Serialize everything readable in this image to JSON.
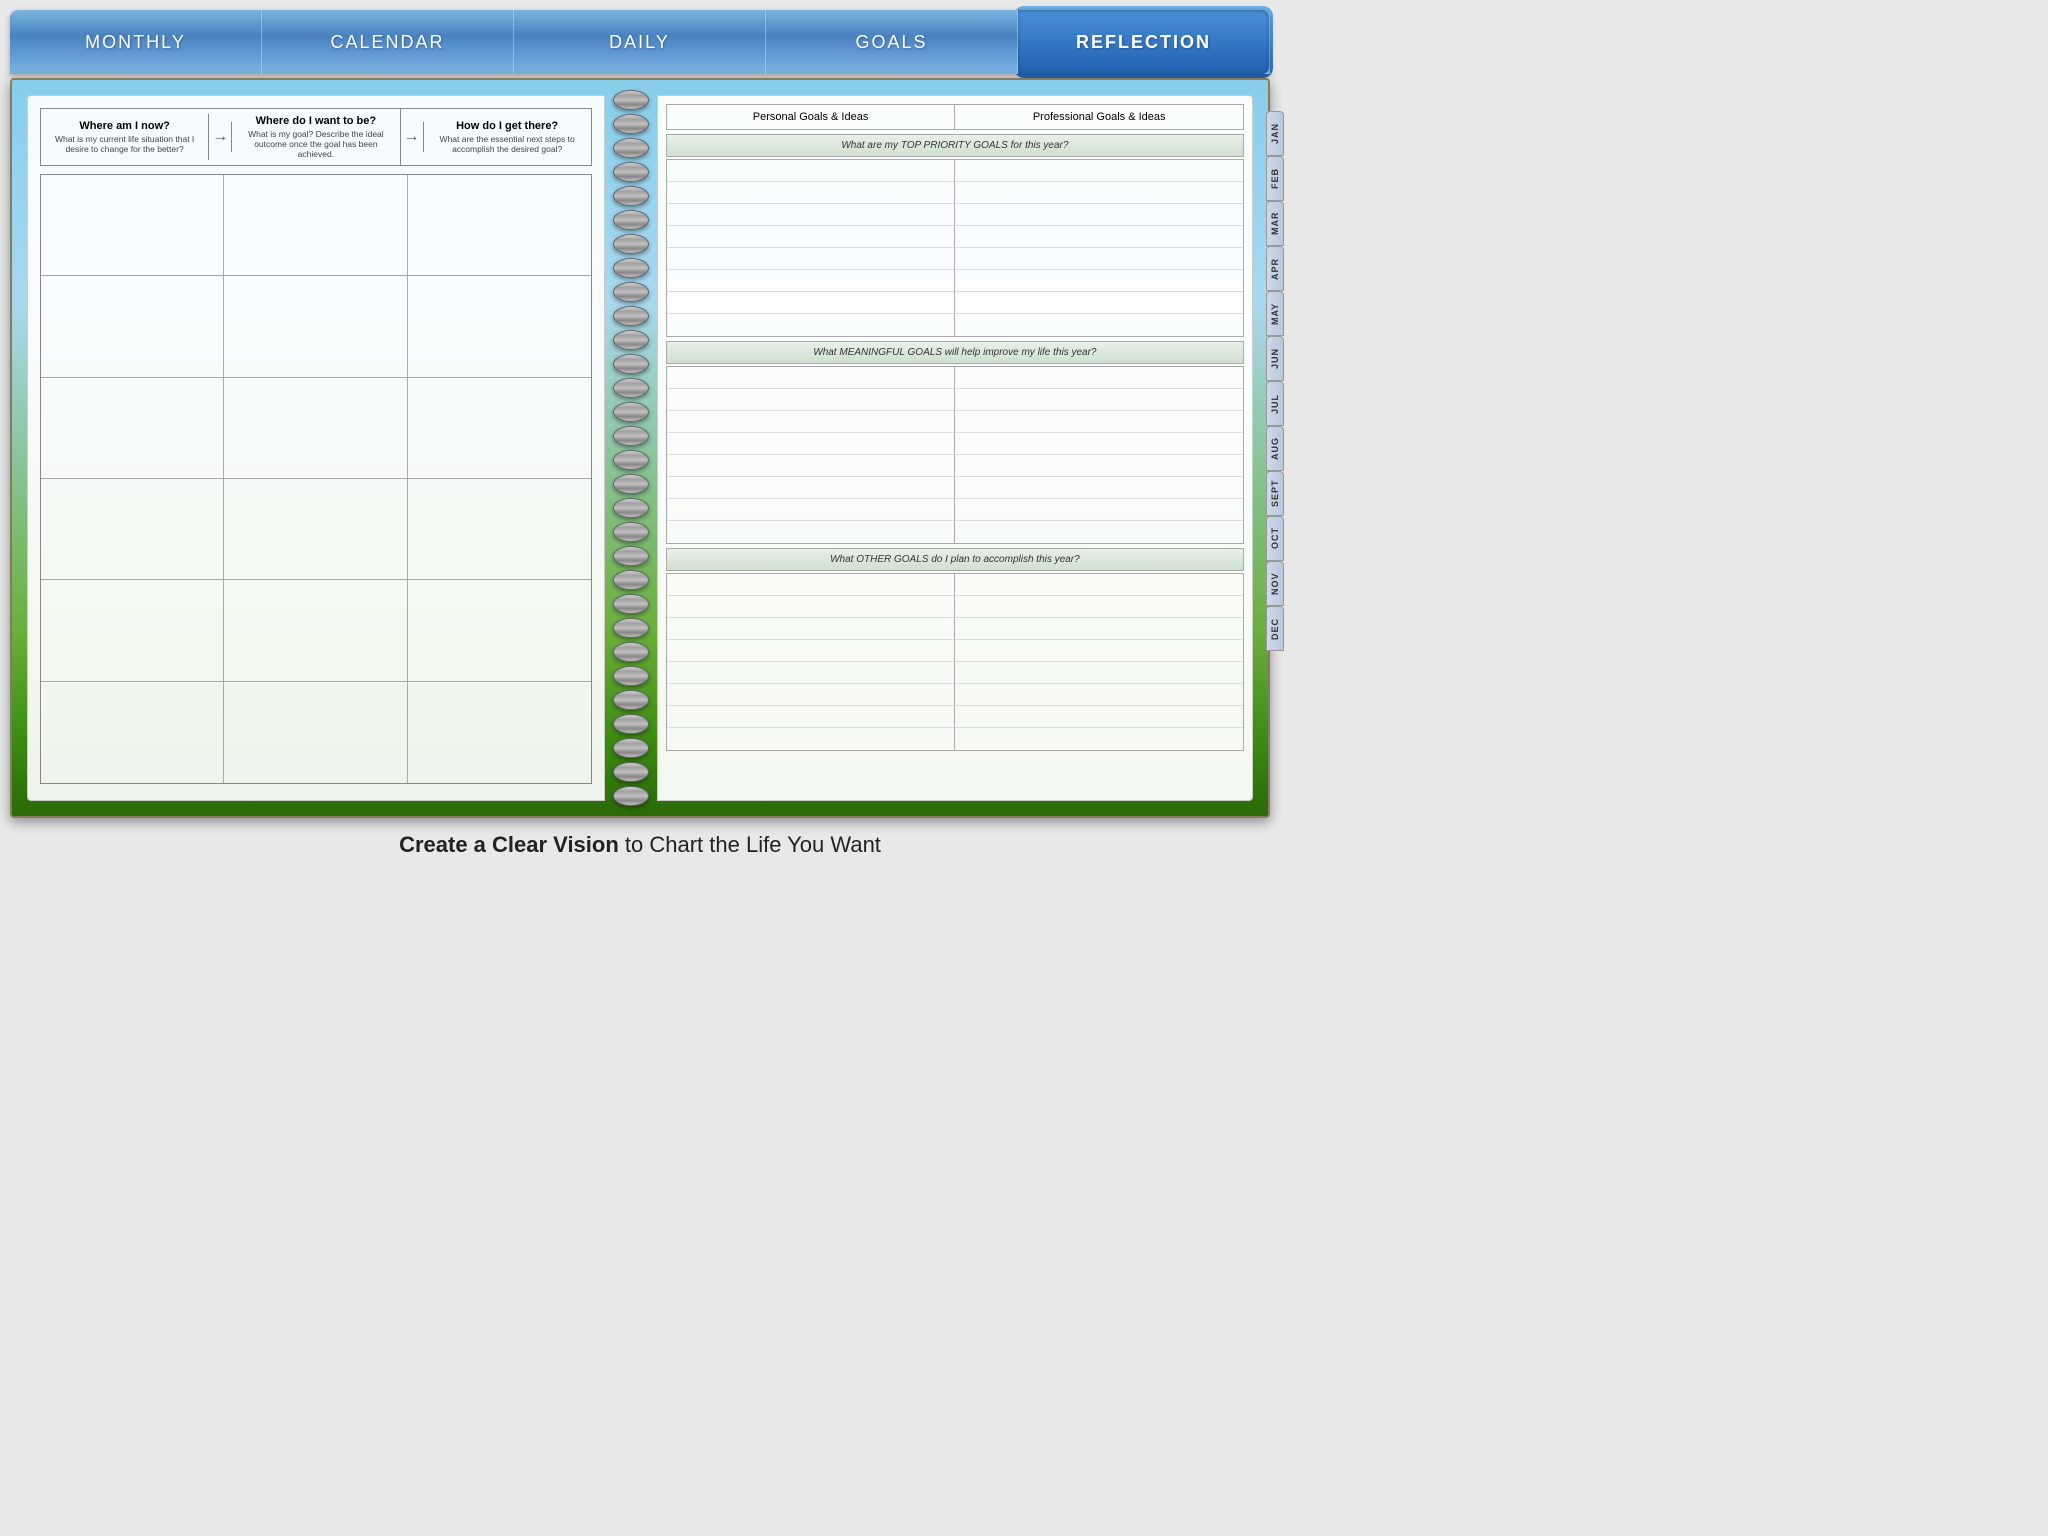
{
  "nav": {
    "items": [
      {
        "id": "monthly",
        "label": "MONTHLY",
        "active": false
      },
      {
        "id": "calendar",
        "label": "CALENDAR",
        "active": false
      },
      {
        "id": "daily",
        "label": "DAILY",
        "active": false
      },
      {
        "id": "goals",
        "label": "GOALS",
        "active": false
      },
      {
        "id": "reflection",
        "label": "REFLECTION",
        "active": true
      }
    ]
  },
  "left_page": {
    "header": [
      {
        "main": "Where am I now?",
        "sub": "What is my current life situation that I desire to change for the better?"
      },
      {
        "main": "Where do I want to be?",
        "sub": "What is my goal? Describe the ideal outcome once the goal has been achieved."
      },
      {
        "main": "How do I get there?",
        "sub": "What are the essential next steps to accomplish the desired goal?"
      }
    ],
    "grid_rows": 6,
    "grid_cols": 3
  },
  "right_page": {
    "headers": [
      "Personal Goals & Ideas",
      "Professional Goals & Ideas"
    ],
    "sections": [
      {
        "label": "What are my TOP PRIORITY GOALS for this year?",
        "lines": 8
      },
      {
        "label": "What MEANINGFUL GOALS will help improve my life this year?",
        "lines": 8
      },
      {
        "label": "What OTHER GOALS do I plan to accomplish this year?",
        "lines": 8
      }
    ]
  },
  "month_tabs": [
    "JAN",
    "FEB",
    "MAR",
    "APR",
    "MAY",
    "JUN",
    "JUL",
    "AUG",
    "SEPT",
    "OCT",
    "NOV",
    "DEC"
  ],
  "bottom_text": {
    "bold": "Create a Clear Vision",
    "normal": " to Chart the Life You Want"
  },
  "spiral_count": 30
}
